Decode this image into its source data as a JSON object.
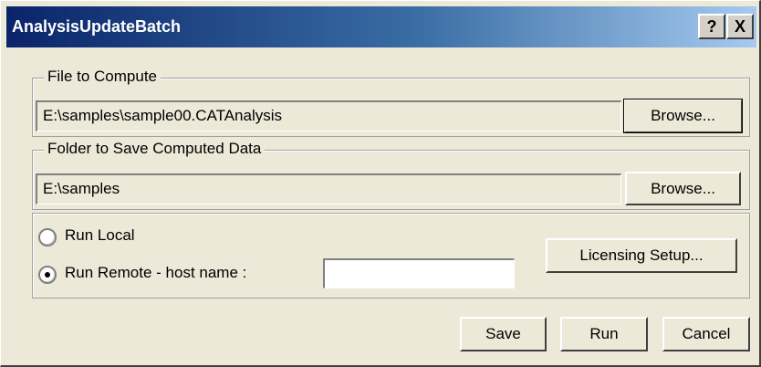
{
  "window": {
    "title": "AnalysisUpdateBatch",
    "help_label": "?",
    "close_label": "X"
  },
  "file_group": {
    "legend": "File to Compute",
    "value": "E:\\samples\\sample00.CATAnalysis",
    "browse_label": "Browse..."
  },
  "folder_group": {
    "legend": "Folder to Save Computed Data",
    "value": "E:\\samples",
    "browse_label": "Browse..."
  },
  "run_group": {
    "run_local_label": "Run Local",
    "run_local_selected": false,
    "run_remote_label": "Run Remote - host name :",
    "run_remote_selected": true,
    "host_name_value": "",
    "licensing_label": "Licensing Setup..."
  },
  "footer": {
    "save_label": "Save",
    "run_label": "Run",
    "cancel_label": "Cancel"
  }
}
